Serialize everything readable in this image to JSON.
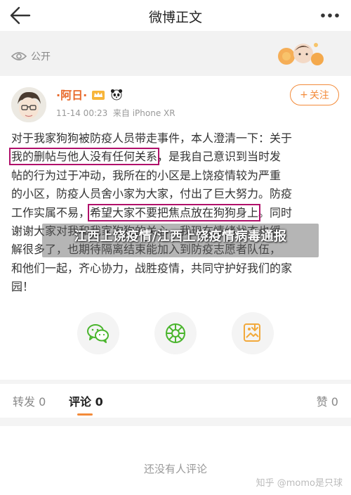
{
  "header": {
    "title": "微博正文",
    "back_icon": "back-arrow-icon",
    "more_icon": "more-dots-icon"
  },
  "visibility": {
    "label": "公开",
    "icon": "eye-icon"
  },
  "post": {
    "author": "·阿日·",
    "time": "11-14 00:23",
    "source": "来自 iPhone XR",
    "follow_label": "关注",
    "lines": [
      {
        "pre": "对于我家狗狗被防疫人员带走事件，本人澄清一下：关于",
        "hl": "",
        "post": ""
      },
      {
        "pre": "",
        "hl": "我的删帖与他人没有任何关系",
        "post": "，是我自己意识到当时发"
      },
      {
        "pre": "帖的行为过于冲动，我所在的小区是上饶疫情较为严重",
        "hl": "",
        "post": ""
      },
      {
        "pre": "的小区，防疫人员舍小家为大家，付出了巨大努力。防疫",
        "hl": "",
        "post": ""
      },
      {
        "pre": "工作实属不易，",
        "hl": "希望大家不要把焦点放在狗狗身上",
        "post": "。同时"
      },
      {
        "pre": "谢谢大家对我和我家狗狗的关心，我现在情绪状态也缓",
        "hl": "",
        "post": ""
      },
      {
        "pre": "解很多了，也期待隔离结束能加入到防疫志愿者队伍，",
        "hl": "",
        "post": ""
      },
      {
        "pre": "和他们一起，齐心协力，战胜疫情，共同守护好我们的家",
        "hl": "",
        "post": ""
      },
      {
        "pre": "园！",
        "hl": "",
        "post": ""
      }
    ],
    "highlight_color": "#b0106a"
  },
  "watermark": "江西上饶疫情/江西上饶疫情病毒通报",
  "share": {
    "wechat_icon": "wechat-icon",
    "moments_icon": "moments-icon",
    "save_icon": "save-image-icon"
  },
  "tabs": {
    "repost": "转发 0",
    "comment": "评论 0",
    "like": "赞 0"
  },
  "comments": {
    "empty": "还没有人评论"
  },
  "credit": "知乎 @momo是只球",
  "colors": {
    "accent": "#f38b3a",
    "author": "#e8692b"
  }
}
